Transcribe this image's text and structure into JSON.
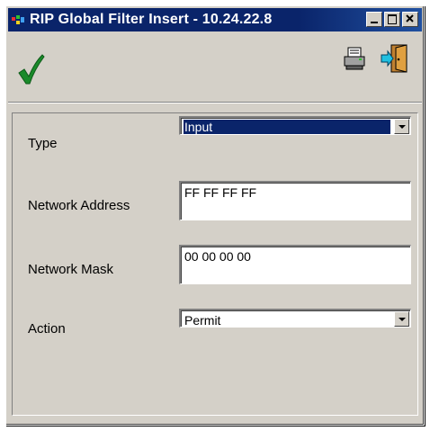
{
  "window": {
    "title": "RIP Global Filter Insert - 10.24.22.8"
  },
  "toolbar": {
    "ok_icon": "checkmark-icon",
    "print_icon": "printer-icon",
    "exit_icon": "exit-door-icon",
    "ok_color": "#1a8a2a"
  },
  "form": {
    "type_label": "Type",
    "type_value": "Input",
    "network_address_label": "Network Address",
    "network_address_value": "FF FF FF FF",
    "network_mask_label": "Network Mask",
    "network_mask_value": "00 00 00 00",
    "action_label": "Action",
    "action_value": "Permit"
  },
  "colors": {
    "title_bar": "#0a246a",
    "window_face": "#d4d0c8",
    "selection": "#0a246a"
  }
}
